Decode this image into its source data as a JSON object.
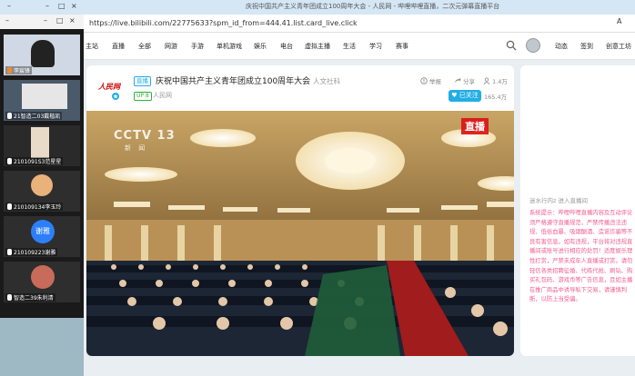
{
  "browser": {
    "title": "庆祝中国共产主义青年团成立100周年大会 - 人民网 - 哔哩哔哩直播，二次元弹幕直播平台",
    "url": "https://live.bilibili.com/22775633?spm_id_from=444.41.list.card_live.click",
    "right_edge": "A",
    "minimize": "–",
    "maximize": "□",
    "close": "×"
  },
  "nav": {
    "items": [
      "主站",
      "直播",
      "全部",
      "网游",
      "手游",
      "单机游戏",
      "娱乐",
      "电台",
      "虚拟主播",
      "生活",
      "学习",
      "赛事"
    ],
    "right_items": [
      "动态",
      "签到",
      "创意工坊"
    ]
  },
  "room": {
    "live_badge": "直播",
    "title": "庆祝中国共产主义青年团成立100周年大会",
    "streamer_line": "人文社科",
    "up_badge": "UP 8",
    "up_name": "人民网",
    "report": "举报",
    "share": "分享",
    "viewers": "1.4万",
    "follow_label": "已关注",
    "fans": "165.4万",
    "logo_text": "人民网"
  },
  "video": {
    "live_tag": "直播",
    "channel": "CCTV 13",
    "channel_sub": "新 闻"
  },
  "chat": {
    "enter_text": "迷水行内z 进入直播间",
    "system_text": "系统提示：哔哩哔哩直播内容及互动评论须严格遵守直播规范，严禁传播违法违规、低俗血暴、吸烟酗酒、造谣诈骗等不良有害信息。如有违规，平台将对违规直播间或账号进行相应的处罚！适度娱乐理性打赏，严禁未成年人直播或打赏。请勿轻信各类招聘征婚、代练代抢、刷钻、购买礼包码、游戏币等广告信息，且如主播在推广商品中诱导私下交易，请谨慎判断，以防上当受骗。"
  },
  "meeting": {
    "participants": [
      {
        "name": "李宸锋"
      },
      {
        "name": "21智造二03戴楷凯"
      },
      {
        "name": "2101091S3范星星"
      },
      {
        "name": "210109134李玉玲"
      },
      {
        "name": "210109223谢雅",
        "avatar_text": "谢雅"
      },
      {
        "name": "智造二39朱利清"
      }
    ]
  },
  "colors": {
    "accent": "#23ade5",
    "pink": "#f25d8e",
    "live_red": "#dc1414"
  }
}
